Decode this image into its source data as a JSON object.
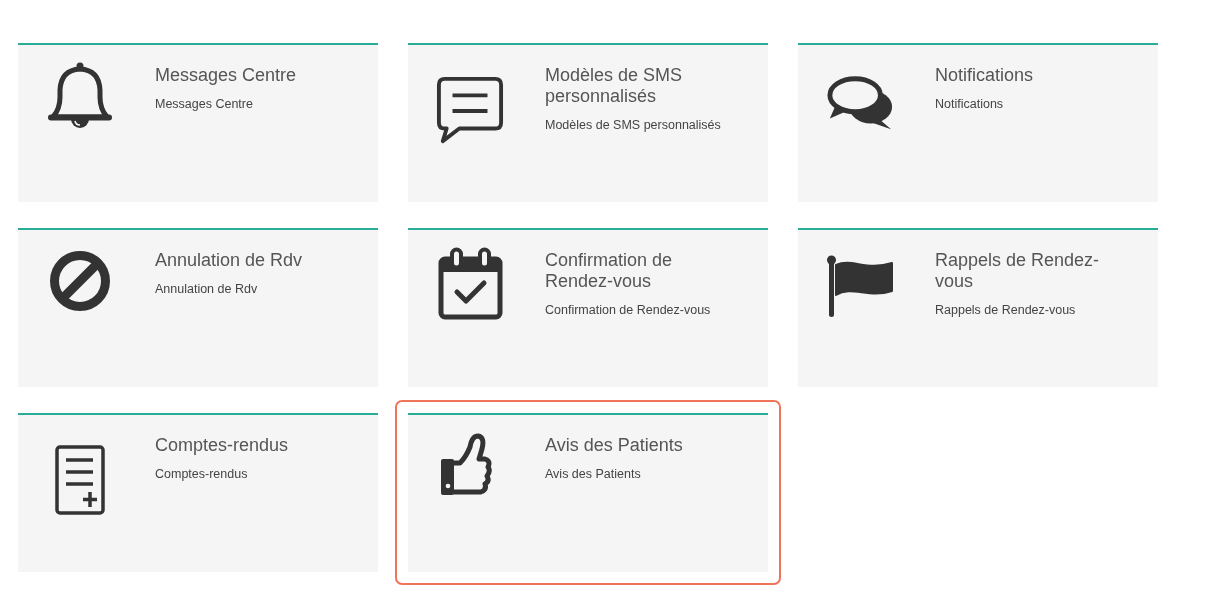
{
  "cards": [
    {
      "kind": "bell",
      "title": "Messages Centre",
      "description": "Messages Centre",
      "selected": false
    },
    {
      "kind": "speech-bubble",
      "title": "Modèles de SMS personnalisés",
      "description": "Modèles de SMS personnalisés",
      "selected": false
    },
    {
      "kind": "chat-bubbles",
      "title": "Notifications",
      "description": "Notifications",
      "selected": false
    },
    {
      "kind": "prohibited",
      "title": "Annulation de Rdv",
      "description": "Annulation de Rdv",
      "selected": false
    },
    {
      "kind": "calendar-check",
      "title": "Confirmation de Rendez-vous",
      "description": "Confirmation de Rendez-vous",
      "selected": false
    },
    {
      "kind": "flag",
      "title": "Rappels de Rendez-vous",
      "description": "Rappels de Rendez-vous",
      "selected": false
    },
    {
      "kind": "document-plus",
      "title": "Comptes-rendus",
      "description": "Comptes-rendus",
      "selected": false
    },
    {
      "kind": "thumbs-up",
      "title": "Avis des Patients",
      "description": "Avis des Patients",
      "selected": true
    }
  ]
}
